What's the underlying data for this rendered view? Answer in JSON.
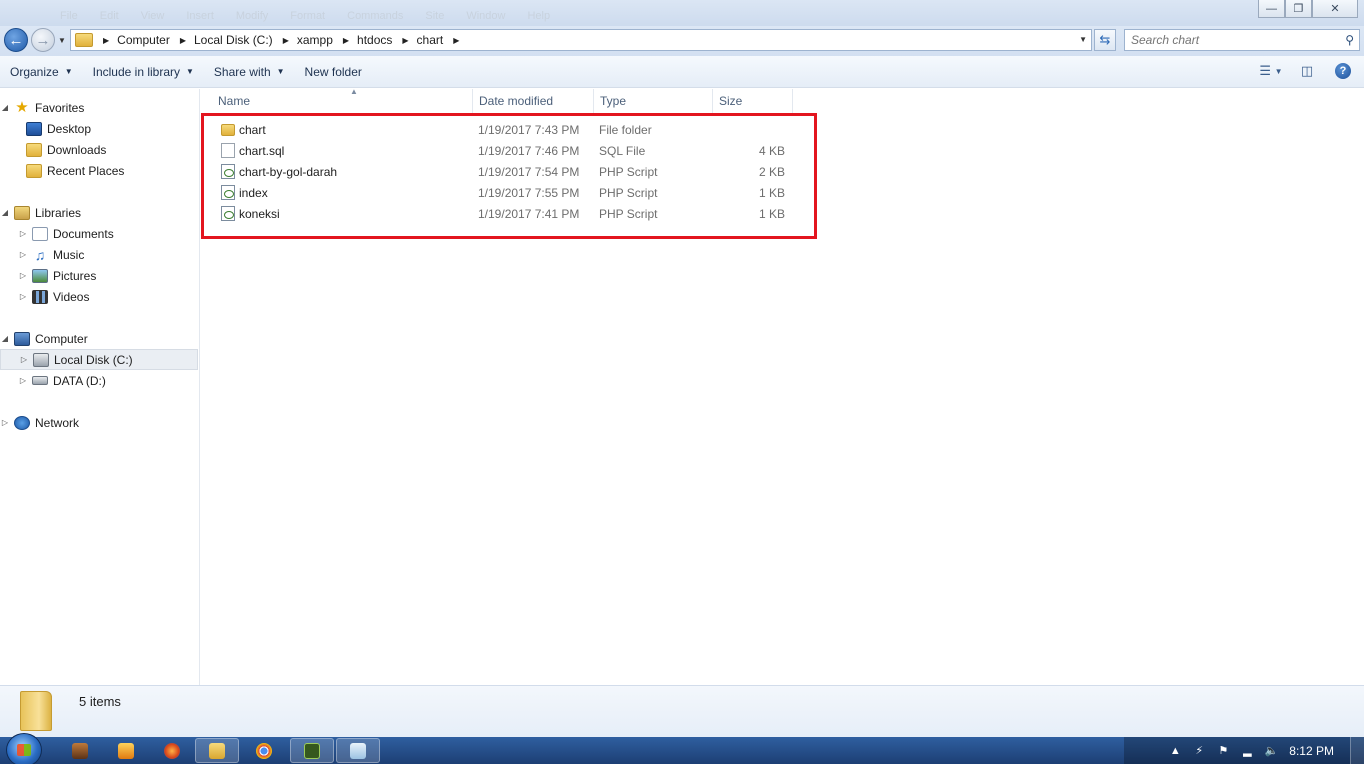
{
  "title_bar": {
    "menu_ghost": [
      "File",
      "Edit",
      "View",
      "Insert",
      "Modify",
      "Format",
      "Commands",
      "Site",
      "Window",
      "Help"
    ]
  },
  "address_bar": {
    "crumbs": [
      "Computer",
      "Local Disk (C:)",
      "xampp",
      "htdocs",
      "chart"
    ]
  },
  "search": {
    "placeholder": "Search chart"
  },
  "toolbar": {
    "organize": "Organize",
    "include_in_library": "Include in library",
    "share_with": "Share with",
    "new_folder": "New folder"
  },
  "nav": {
    "favorites": "Favorites",
    "desktop": "Desktop",
    "downloads": "Downloads",
    "recent_places": "Recent Places",
    "libraries": "Libraries",
    "documents": "Documents",
    "music": "Music",
    "pictures": "Pictures",
    "videos": "Videos",
    "computer": "Computer",
    "local_disk": "Local Disk (C:)",
    "data_disk": "DATA (D:)",
    "network": "Network"
  },
  "columns": {
    "name": "Name",
    "date_modified": "Date modified",
    "type": "Type",
    "size": "Size"
  },
  "files": [
    {
      "name": "chart",
      "date": "1/19/2017 7:43 PM",
      "type": "File folder",
      "size": "",
      "icon": "folder-icon"
    },
    {
      "name": "chart.sql",
      "date": "1/19/2017 7:46 PM",
      "type": "SQL File",
      "size": "4 KB",
      "icon": "sql-file-icon"
    },
    {
      "name": "chart-by-gol-darah",
      "date": "1/19/2017 7:54 PM",
      "type": "PHP Script",
      "size": "2 KB",
      "icon": "php-file-icon"
    },
    {
      "name": "index",
      "date": "1/19/2017 7:55 PM",
      "type": "PHP Script",
      "size": "1 KB",
      "icon": "php-file-icon"
    },
    {
      "name": "koneksi",
      "date": "1/19/2017 7:41 PM",
      "type": "PHP Script",
      "size": "1 KB",
      "icon": "php-file-icon"
    }
  ],
  "status": {
    "items_count": "5 items"
  },
  "taskbar": {
    "clock": "8:12 PM"
  },
  "colors": {
    "highlight_border": "#e3151f",
    "taskbar": "#1d3f74"
  }
}
